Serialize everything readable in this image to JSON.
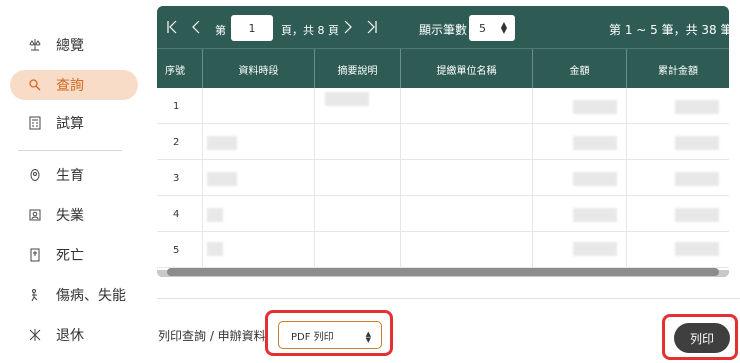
{
  "sidebar": {
    "items": [
      {
        "label": "總覽",
        "icon": "scale-icon"
      },
      {
        "label": "查詢",
        "icon": "search-icon",
        "active": true
      },
      {
        "label": "試算",
        "icon": "calculator-icon"
      },
      {
        "label": "生育",
        "icon": "pregnancy-icon"
      },
      {
        "label": "失業",
        "icon": "unemployed-icon"
      },
      {
        "label": "死亡",
        "icon": "death-icon"
      },
      {
        "label": "傷病、失能",
        "icon": "injury-icon"
      },
      {
        "label": "退休",
        "icon": "retire-icon"
      }
    ],
    "active_color": "#d2691e"
  },
  "pager": {
    "page_prefix": "第",
    "page_value": "1",
    "page_suffix": "頁，共 8 頁",
    "page_size_label": "顯示筆數",
    "page_size_value": "5",
    "summary": "第 1 ~ 5 筆，共 38 筆"
  },
  "table": {
    "columns": [
      "序號",
      "資料時段",
      "摘要說明",
      "提繳單位名稱",
      "金額",
      "累計金額"
    ],
    "rows": [
      "1",
      "2",
      "3",
      "4",
      "5"
    ]
  },
  "footer": {
    "print_label": "列印查詢 / 申辦資料",
    "pdf_option": "PDF 列印",
    "print_button": "列印"
  },
  "colors": {
    "table_header": "#2e5c55",
    "highlight": "#e43030",
    "button_dark": "#3f3f3f"
  }
}
